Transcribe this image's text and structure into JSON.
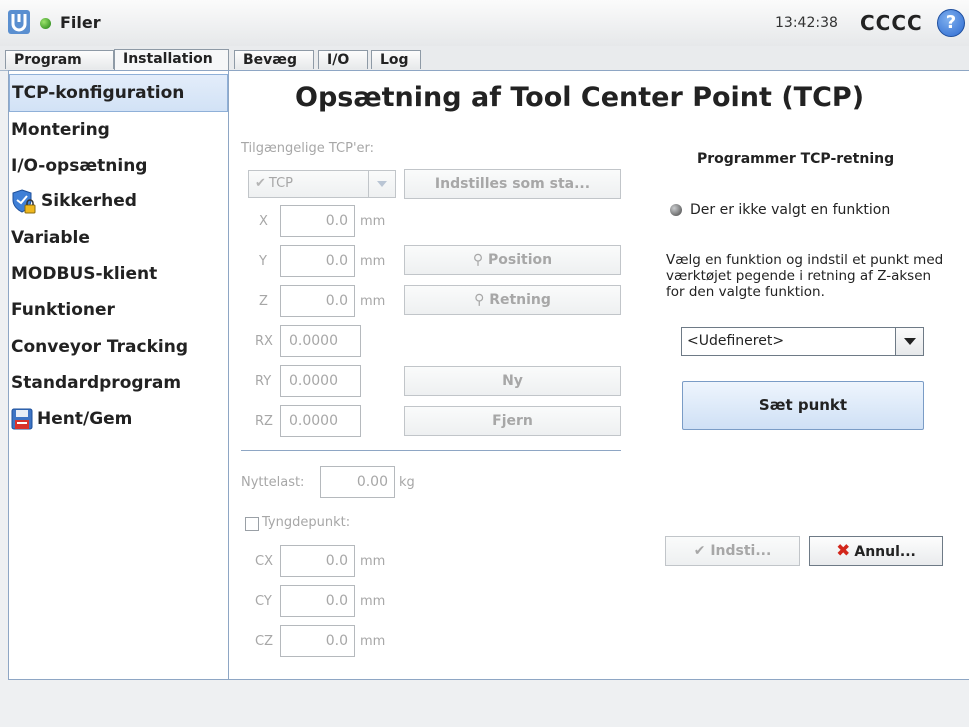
{
  "header": {
    "app_title": "Filer",
    "clock": "13:42:38",
    "robot_name": "CCCC",
    "help_label": "?"
  },
  "tabs": [
    {
      "label": "Program",
      "active": false
    },
    {
      "label": "Installation",
      "active": true
    },
    {
      "label": "Bevæg",
      "active": false
    },
    {
      "label": "I/O",
      "active": false
    },
    {
      "label": "Log",
      "active": false
    }
  ],
  "sidebar": {
    "items": [
      {
        "label": "TCP-konfiguration",
        "selected": true
      },
      {
        "label": "Montering"
      },
      {
        "label": "I/O-opsætning"
      },
      {
        "label": "Sikkerhed",
        "icon": "safety-shield-lock-icon"
      },
      {
        "label": "Variable"
      },
      {
        "label": "MODBUS-klient"
      },
      {
        "label": "Funktioner"
      },
      {
        "label": "Conveyor Tracking"
      },
      {
        "label": "Standardprogram"
      },
      {
        "label": "Hent/Gem",
        "icon": "floppy-disk-icon"
      }
    ]
  },
  "main": {
    "title": "Opsætning af Tool Center Point (TCP)",
    "available_label": "Tilgængelige TCP'er:",
    "tcp_select_value": "TCP",
    "set_default_button": "Indstilles som sta...",
    "position_button": "Position",
    "direction_button": "Retning",
    "new_button": "Ny",
    "remove_button": "Fjern",
    "coords": {
      "x": {
        "label": "X",
        "value": "0.0",
        "unit": "mm"
      },
      "y": {
        "label": "Y",
        "value": "0.0",
        "unit": "mm"
      },
      "z": {
        "label": "Z",
        "value": "0.0",
        "unit": "mm"
      },
      "rx": {
        "label": "RX",
        "value": "0.0000"
      },
      "ry": {
        "label": "RY",
        "value": "0.0000"
      },
      "rz": {
        "label": "RZ",
        "value": "0.0000"
      }
    },
    "payload_label": "Nyttelast:",
    "payload_value": "0.00",
    "payload_unit": "kg",
    "cog_label": "Tyngdepunkt:",
    "cog": {
      "cx": {
        "label": "CX",
        "value": "0.0",
        "unit": "mm"
      },
      "cy": {
        "label": "CY",
        "value": "0.0",
        "unit": "mm"
      },
      "cz": {
        "label": "CZ",
        "value": "0.0",
        "unit": "mm"
      }
    }
  },
  "right_panel": {
    "title": "Programmer TCP-retning",
    "status": "Der er ikke valgt en funktion",
    "description": "Vælg en funktion og indstil et punkt med værktøjet pegende i retning af Z-aksen for den valgte funktion.",
    "feature_select_value": "<Udefineret>",
    "set_point_button": "Sæt punkt",
    "apply_button": "Indsti...",
    "cancel_button": "Annul..."
  },
  "colors": {
    "accent_blue": "#8ea6c4",
    "cancel_red": "#d2261b",
    "status_green": "#1c7d12"
  }
}
